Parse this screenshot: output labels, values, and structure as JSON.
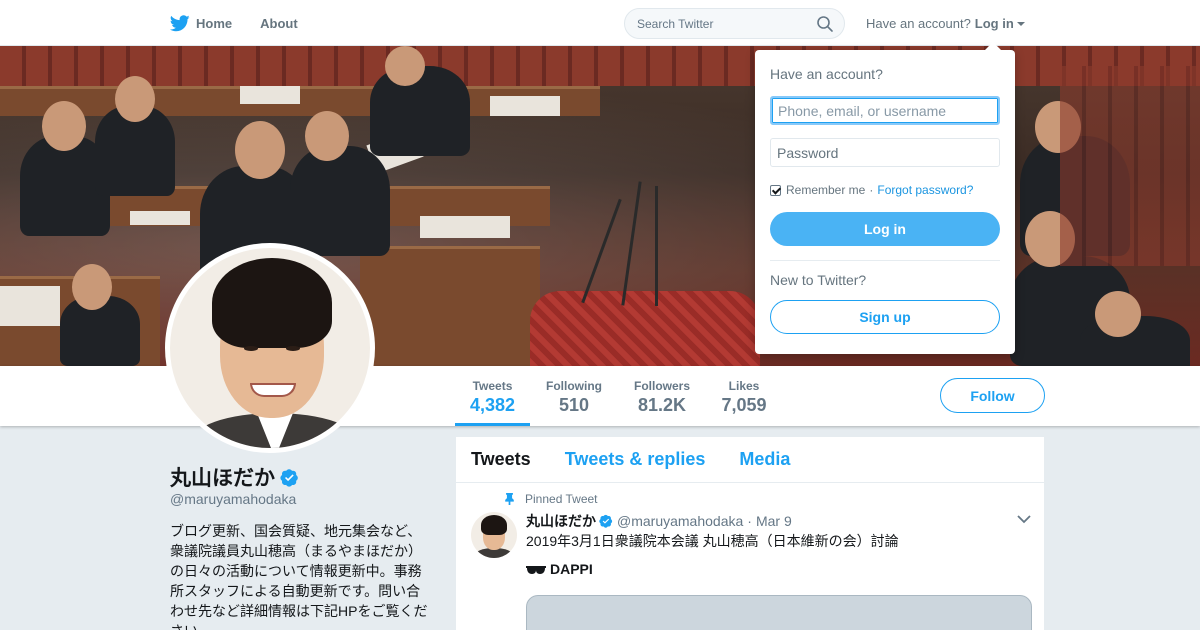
{
  "nav": {
    "home_label": "Home",
    "about_label": "About",
    "search_placeholder": "Search Twitter",
    "have_account": "Have an account?",
    "login_link": "Log in"
  },
  "login_dropdown": {
    "title": "Have an account?",
    "username_placeholder": "Phone, email, or username",
    "password_placeholder": "Password",
    "remember_me": "Remember me",
    "separator": "·",
    "forgot_password": "Forgot password?",
    "login_button": "Log in",
    "new_to_twitter": "New to Twitter?",
    "signup_button": "Sign up",
    "remember_checked": true
  },
  "profile": {
    "name": "丸山ほだか",
    "screen_name": "@maruyamahodaka",
    "bio": "ブログ更新、国会質疑、地元集会など、衆議院議員丸山穂高（まるやまほだか）の日々の活動について情報更新中。事務所スタッフによる自動更新です。問い合わせ先など詳細情報は下記HPをご覧ください。",
    "verified": true
  },
  "stats": [
    {
      "label": "Tweets",
      "value": "4,382"
    },
    {
      "label": "Following",
      "value": "510"
    },
    {
      "label": "Followers",
      "value": "81.2K"
    },
    {
      "label": "Likes",
      "value": "7,059"
    }
  ],
  "follow_button": "Follow",
  "timeline": {
    "tabs": [
      "Tweets",
      "Tweets & replies",
      "Media"
    ],
    "pinned_label": "Pinned Tweet",
    "tweet": {
      "name": "丸山ほだか",
      "handle": "@maruyamahodaka",
      "date_sep": "·",
      "date": "Mar 9",
      "text": "2019年3月1日衆議院本会議 丸山穂高（日本維新の会）討論",
      "text2": "DAPPI"
    }
  },
  "colors": {
    "accent": "#1da1f2",
    "login_button": "#4ab3f4",
    "background": "#e6ecf0"
  },
  "icons": {
    "logo": "twitter-bird-icon",
    "search": "search-icon",
    "verified": "verified-badge-icon",
    "pin": "pin-icon",
    "tweet_menu": "chevron-down-icon",
    "sunglasses": "sunglasses-emoji-icon"
  }
}
